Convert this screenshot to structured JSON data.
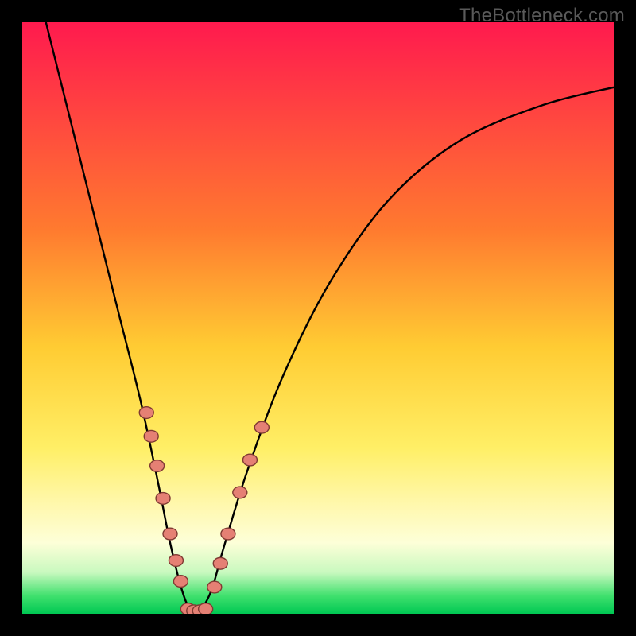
{
  "watermark": "TheBottleneck.com",
  "chart_data": {
    "type": "line",
    "title": "",
    "xlabel": "",
    "ylabel": "",
    "xlim": [
      0,
      100
    ],
    "ylim": [
      0,
      100
    ],
    "grid": false,
    "legend": false,
    "gradient_stops": [
      {
        "offset": 0,
        "color": "#ff1a4e"
      },
      {
        "offset": 35,
        "color": "#ff7a2f"
      },
      {
        "offset": 55,
        "color": "#ffcc33"
      },
      {
        "offset": 72,
        "color": "#ffef66"
      },
      {
        "offset": 82,
        "color": "#fff8b0"
      },
      {
        "offset": 88,
        "color": "#fdffd8"
      },
      {
        "offset": 93,
        "color": "#c9f9bf"
      },
      {
        "offset": 97,
        "color": "#3fe06d"
      },
      {
        "offset": 100,
        "color": "#00c853"
      }
    ],
    "series": [
      {
        "name": "bottleneck-curve",
        "x": [
          4,
          10,
          16,
          20,
          23,
          25,
          27,
          28.5,
          30,
          32,
          34,
          38,
          44,
          52,
          62,
          74,
          88,
          100
        ],
        "y": [
          100,
          76,
          52,
          36,
          22,
          12,
          4,
          0.5,
          0.5,
          4,
          11,
          24,
          40,
          56,
          70,
          80,
          86,
          89
        ]
      }
    ],
    "markers_left": [
      {
        "x": 21.0,
        "y": 34.0
      },
      {
        "x": 21.8,
        "y": 30.0
      },
      {
        "x": 22.8,
        "y": 25.0
      },
      {
        "x": 23.8,
        "y": 19.5
      },
      {
        "x": 25.0,
        "y": 13.5
      },
      {
        "x": 26.0,
        "y": 9.0
      },
      {
        "x": 26.8,
        "y": 5.5
      }
    ],
    "markers_bottom": [
      {
        "x": 28.0,
        "y": 0.8
      },
      {
        "x": 29.0,
        "y": 0.5
      },
      {
        "x": 30.0,
        "y": 0.5
      },
      {
        "x": 31.0,
        "y": 0.8
      }
    ],
    "markers_right": [
      {
        "x": 32.5,
        "y": 4.5
      },
      {
        "x": 33.5,
        "y": 8.5
      },
      {
        "x": 34.8,
        "y": 13.5
      },
      {
        "x": 36.8,
        "y": 20.5
      },
      {
        "x": 38.5,
        "y": 26.0
      },
      {
        "x": 40.5,
        "y": 31.5
      }
    ],
    "marker_style": {
      "fill": "#e58074",
      "stroke": "#803a33",
      "r": 9
    }
  }
}
